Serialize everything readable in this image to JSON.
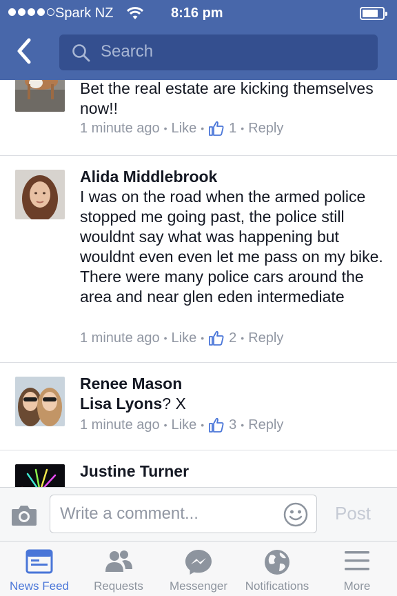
{
  "status_bar": {
    "carrier": "Spark NZ",
    "time": "8:16 pm"
  },
  "search": {
    "placeholder": "Search"
  },
  "comments": [
    {
      "name": "",
      "text": "Bet the real estate are kicking themselves now!!",
      "time": "1 minute ago",
      "like_label": "Like",
      "like_count": "1",
      "reply_label": "Reply",
      "avatar_icon": "dog-photo"
    },
    {
      "name": "Alida Middlebrook",
      "text": "I was on the road when the armed police stopped me going past, the police still wouldnt say what was happening but wouldnt even even let me pass on my bike. There were many police cars around the area and near glen eden intermediate",
      "time": "1 minute ago",
      "like_label": "Like",
      "like_count": "2",
      "reply_label": "Reply",
      "avatar_icon": "profile-photo"
    },
    {
      "name": "Renee Mason",
      "mention": "Lisa Lyons",
      "text": "? X",
      "time": "1 minute ago",
      "like_label": "Like",
      "like_count": "3",
      "reply_label": "Reply",
      "avatar_icon": "two-women-selfie-photo"
    },
    {
      "name": "Justine Turner",
      "avatar_icon": "fireworks-photo"
    }
  ],
  "composer": {
    "placeholder": "Write a comment...",
    "post_label": "Post"
  },
  "tabs": [
    {
      "label": "News Feed",
      "icon": "news-feed-icon",
      "active": true
    },
    {
      "label": "Requests",
      "icon": "friends-icon",
      "active": false
    },
    {
      "label": "Messenger",
      "icon": "messenger-icon",
      "active": false
    },
    {
      "label": "Notifications",
      "icon": "globe-icon",
      "active": false
    },
    {
      "label": "More",
      "icon": "menu-icon",
      "active": false
    }
  ],
  "colors": {
    "brand": "#4867aa",
    "active_tab": "#4a76d8",
    "meta_text": "#9197a3"
  }
}
